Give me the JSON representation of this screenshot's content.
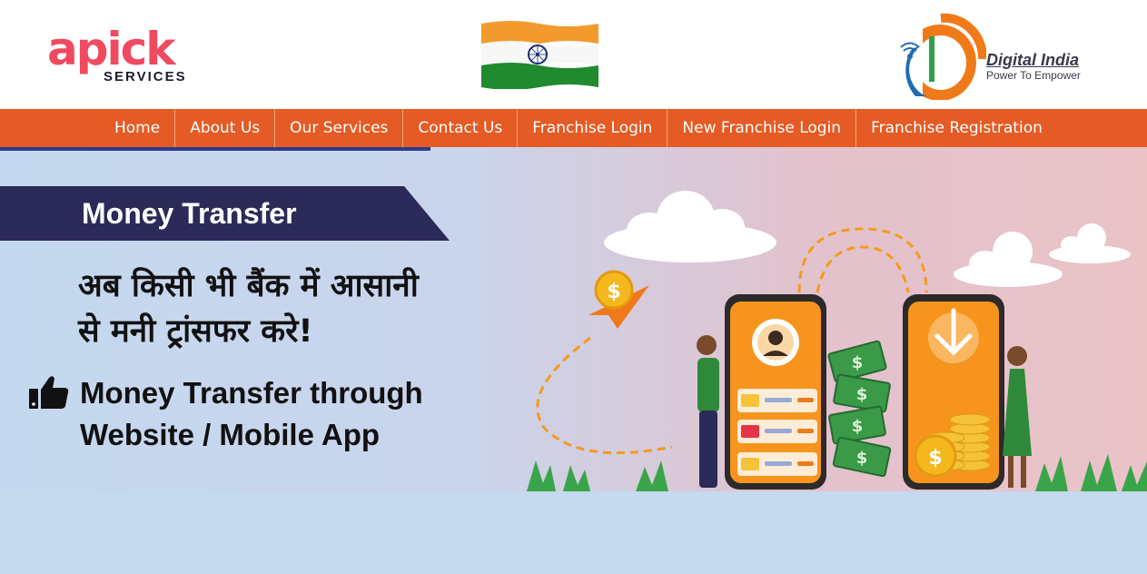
{
  "header": {
    "logo_mark": "apick",
    "logo_sub": "SERVICES",
    "digital_india_title": "Digital India",
    "digital_india_tag": "Power To Empower"
  },
  "nav": {
    "items": [
      {
        "label": "Home"
      },
      {
        "label": "About Us"
      },
      {
        "label": "Our Services"
      },
      {
        "label": "Contact Us"
      },
      {
        "label": "Franchise Login"
      },
      {
        "label": "New Franchise Login"
      },
      {
        "label": "Franchise Registration"
      }
    ]
  },
  "banner": {
    "ribbon_title": "Money Transfer",
    "hindi_line1": "अब किसी भी बैंक में आसानी",
    "hindi_line2": "से मनी ट्रांसफर करे!",
    "feature_line1": "Money Transfer through",
    "feature_line2": "Website / Mobile App"
  },
  "colors": {
    "nav_bg": "#e45b25",
    "ribbon_bg": "#2c2a58",
    "page_bg": "#c5d9ef",
    "brand_pink": "#ef4a5f",
    "phone_orange": "#f7941d"
  },
  "icons": [
    "india-flag-icon",
    "digital-india-icon",
    "thumbs-up-icon",
    "user-avatar-icon",
    "download-arrow-icon",
    "dollar-coin-icon",
    "cloud-icon"
  ]
}
